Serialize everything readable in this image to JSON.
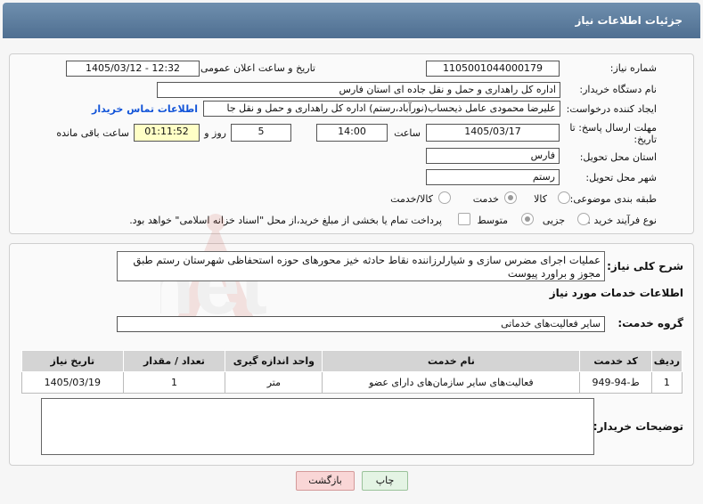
{
  "header": {
    "title": "جزئیات اطلاعات نیاز"
  },
  "fields": {
    "need_number_label": "شماره نیاز:",
    "need_number": "1105001044000179",
    "announce_label": "تاریخ و ساعت اعلان عمومی:",
    "announce_value": "1405/03/12 - 12:32",
    "buyer_org_label": "نام دستگاه خریدار:",
    "buyer_org": "اداره کل راهداری و حمل و نقل جاده ای استان فارس",
    "creator_label": "ایجاد کننده درخواست:",
    "creator": "علیرضا محمودی عامل ذیحساب(نورآباد،رستم) اداره کل راهداری و حمل و نقل جا",
    "contact_link": "اطلاعات تماس خریدار",
    "deadline_label": "مهلت ارسال پاسخ: تا تاریخ:",
    "deadline_date": "1405/03/17",
    "time_label": "ساعت",
    "deadline_time": "14:00",
    "days_value": "5",
    "days_label": "روز و",
    "remaining_value": "01:11:52",
    "remaining_label": "ساعت باقی مانده",
    "province_label": "استان محل تحویل:",
    "province": "فارس",
    "city_label": "شهر محل تحویل:",
    "city": "رستم",
    "category_label": "طبقه بندی موضوعی:",
    "category_options": [
      "کالا",
      "خدمت",
      "کالا/خدمت"
    ],
    "category_selected": "خدمت",
    "process_label": "نوع فرآیند خرید :",
    "process_options": [
      "جزیی",
      "متوسط"
    ],
    "process_selected": "متوسط",
    "treasury_note": "پرداخت تمام یا بخشی از مبلغ خرید،از محل \"اسناد خزانه اسلامی\" خواهد بود."
  },
  "description": {
    "label": "شرح کلی نیاز:",
    "text": "عملیات اجرای مضرس سازی و شیارلرزاننده نقاط حادثه خیز محورهای حوزه استحفاظی شهرستان رستم طبق مجوز و براورد پیوست"
  },
  "services": {
    "title": "اطلاعات خدمات مورد نیاز",
    "group_label": "گروه خدمت:",
    "group_value": "سایر فعالیت‌های خدماتی",
    "table": {
      "headers": [
        "ردیف",
        "کد خدمت",
        "نام خدمت",
        "واحد اندازه گیری",
        "تعداد / مقدار",
        "تاریخ نیاز"
      ],
      "rows": [
        [
          "1",
          "ط-94-949",
          "فعالیت‌های سایر سازمان‌های دارای عضو",
          "متر",
          "1",
          "1405/03/19"
        ]
      ]
    }
  },
  "buyer_notes": {
    "label": "توضیحات خریدار:",
    "value": ""
  },
  "buttons": {
    "print": "چاپ",
    "back": "بازگشت"
  },
  "watermark": {
    "text": "AriaTender.net"
  },
  "colors": {
    "header": "#5a7a9c",
    "link": "#1254d8",
    "back_button": "#f9d6d6",
    "print_button": "#e4f4e4",
    "remaining_bg": "#ffffc6"
  }
}
